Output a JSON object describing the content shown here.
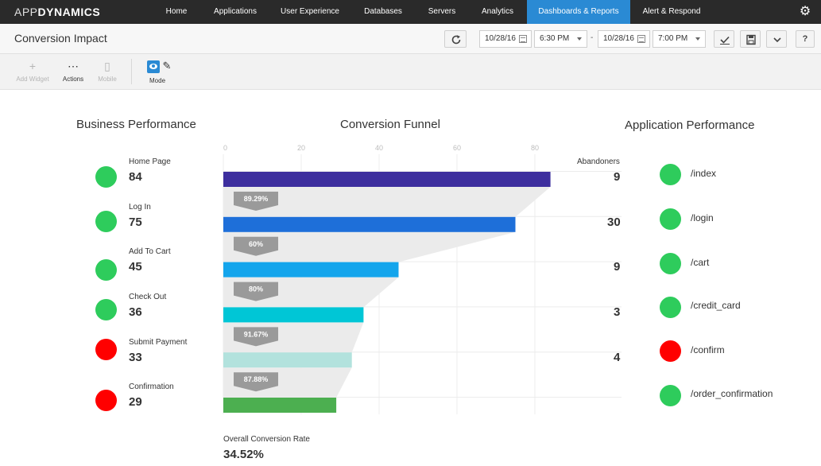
{
  "nav": {
    "logo_light": "APP",
    "logo_bold": "DYNAMICS",
    "items": [
      {
        "label": "Home"
      },
      {
        "label": "Applications"
      },
      {
        "label": "User Experience"
      },
      {
        "label": "Databases"
      },
      {
        "label": "Servers"
      },
      {
        "label": "Analytics"
      },
      {
        "label": "Dashboards & Reports",
        "active": true
      },
      {
        "label": "Alert & Respond"
      }
    ]
  },
  "titlebar": {
    "title": "Conversion Impact",
    "start_date": "10/28/16",
    "start_time": "6:30 PM",
    "separator": "-",
    "end_date": "10/28/16",
    "end_time": "7:00 PM",
    "help": "?"
  },
  "toolbar": {
    "add_widget": "Add Widget",
    "actions": "Actions",
    "mobile": "Mobile",
    "mode": "Mode"
  },
  "sections": {
    "business": "Business Performance",
    "funnel": "Conversion Funnel",
    "application": "Application Performance"
  },
  "colors": {
    "good": "#2ecc5c",
    "bad": "#ff0000",
    "active_nav": "#2a8ad4",
    "funnel_bg": "#ebebeb"
  },
  "chart_data": {
    "type": "bar",
    "orientation": "horizontal",
    "title": "Conversion Funnel",
    "xlim": [
      0,
      80
    ],
    "xticks": [
      0,
      20,
      40,
      60,
      80
    ],
    "categories": [
      "Home Page",
      "Log In",
      "Add To Cart",
      "Check Out",
      "Submit Payment",
      "Confirmation"
    ],
    "values": [
      84,
      75,
      45,
      36,
      33,
      29
    ],
    "bar_colors": [
      "#3d2e9e",
      "#1e6fd9",
      "#14a5ec",
      "#00c6d6",
      "#b2e2dd",
      "#4caf50"
    ],
    "step_rates": [
      "89.29%",
      "60%",
      "80%",
      "91.67%",
      "87.88%"
    ],
    "abandoners_title": "Abandoners",
    "abandoners": [
      9,
      30,
      9,
      3,
      4
    ],
    "overall_label": "Overall Conversion Rate",
    "overall_value": "34.52%",
    "grid": true
  },
  "business": [
    {
      "label": "Home Page",
      "value": "84",
      "status": "good"
    },
    {
      "label": "Log In",
      "value": "75",
      "status": "good"
    },
    {
      "label": "Add To Cart",
      "value": "45",
      "status": "good"
    },
    {
      "label": "Check Out",
      "value": "36",
      "status": "good"
    },
    {
      "label": "Submit Payment",
      "value": "33",
      "status": "bad"
    },
    {
      "label": "Confirmation",
      "value": "29",
      "status": "bad"
    }
  ],
  "application": [
    {
      "label": "/index",
      "status": "good"
    },
    {
      "label": "/login",
      "status": "good"
    },
    {
      "label": "/cart",
      "status": "good"
    },
    {
      "label": "/credit_card",
      "status": "good"
    },
    {
      "label": "/confirm",
      "status": "bad"
    },
    {
      "label": "/order_confirmation",
      "status": "good"
    }
  ]
}
